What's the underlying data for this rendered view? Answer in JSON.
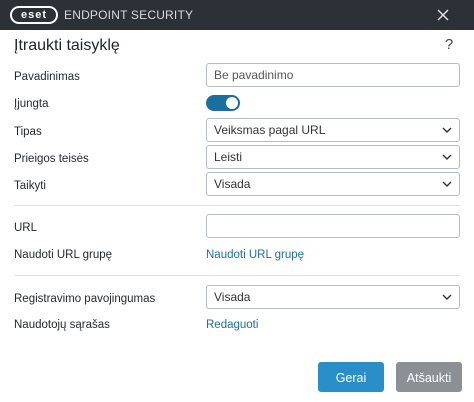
{
  "titlebar": {
    "logo_text": "eset",
    "app_title": "ENDPOINT SECURITY",
    "close_icon": "close-icon"
  },
  "dialog": {
    "title": "Įtraukti taisyklę",
    "help_glyph": "?"
  },
  "form": {
    "name": {
      "label": "Pavadinimas",
      "placeholder": "Be pavadinimo",
      "value": ""
    },
    "enabled": {
      "label": "Įjungta",
      "value": true
    },
    "type": {
      "label": "Tipas",
      "value": "Veiksmas pagal URL"
    },
    "access": {
      "label": "Prieigos teisės",
      "value": "Leisti"
    },
    "apply": {
      "label": "Taikyti",
      "value": "Visada"
    },
    "url": {
      "label": "URL",
      "value": ""
    },
    "url_group": {
      "label": "Naudoti URL grupę",
      "link": "Naudoti URL grupę"
    },
    "log_severity": {
      "label": "Registravimo pavojingumas",
      "value": "Visada"
    },
    "user_list": {
      "label": "Naudotojų sąrašas",
      "link": "Redaguoti"
    }
  },
  "buttons": {
    "ok": "Gerai",
    "cancel": "Atšaukti"
  },
  "colors": {
    "titlebar_bg": "#2c3137",
    "accent": "#1b6fa0",
    "link": "#1e6ea1",
    "primary_button": "#2a8fc9",
    "secondary_button": "#8a9096"
  }
}
